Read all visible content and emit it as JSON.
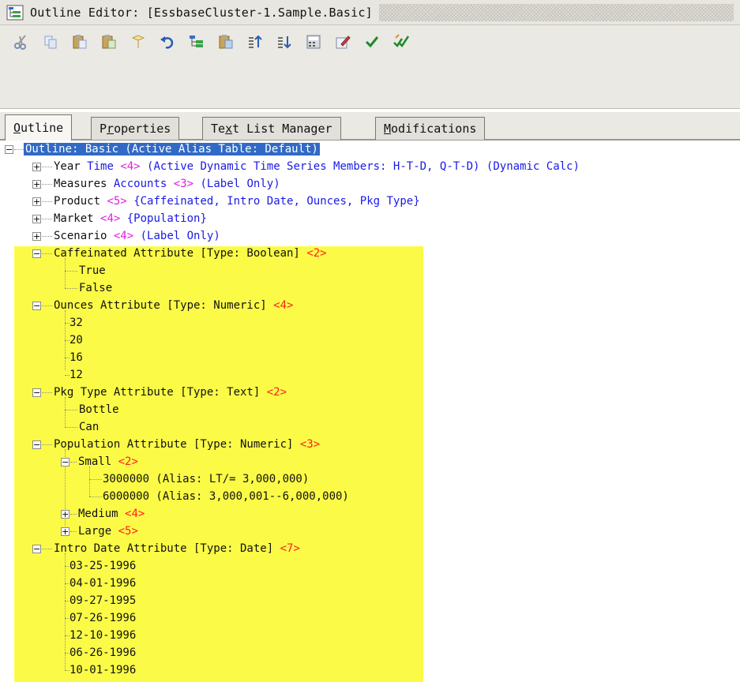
{
  "window": {
    "title": "Outline Editor: [EssbaseCluster-1.Sample.Basic]"
  },
  "toolbar": {
    "buttons": [
      {
        "icon": "cut-icon"
      },
      {
        "icon": "copy-icon"
      },
      {
        "icon": "paste-icon"
      },
      {
        "icon": "paste-child-icon"
      },
      {
        "icon": "delete-icon"
      },
      {
        "icon": "undo-icon"
      },
      {
        "icon": "add-child-icon"
      },
      {
        "icon": "add-sibling-icon"
      },
      {
        "icon": "sort-ascending-icon"
      },
      {
        "icon": "sort-descending-icon"
      },
      {
        "icon": "calculator-icon"
      },
      {
        "icon": "edit-properties-icon"
      },
      {
        "icon": "verify-icon"
      },
      {
        "icon": "verify-all-icon"
      }
    ]
  },
  "tabs": [
    {
      "label_pre": "",
      "label_u": "O",
      "label_post": "utline"
    },
    {
      "label_pre": "P",
      "label_u": "r",
      "label_post": "operties"
    },
    {
      "label_pre": "Te",
      "label_u": "x",
      "label_post": "t List Manager"
    },
    {
      "label_pre": "",
      "label_u": "M",
      "label_post": "odifications"
    }
  ],
  "tree": {
    "root": "Outline: Basic (Active Alias Table: Default)",
    "dimensions": [
      {
        "name": "Year",
        "a": "Time",
        "count": "<4>",
        "b": "(Active Dynamic Time Series Members: H-T-D, Q-T-D) (Dynamic Calc)"
      },
      {
        "name": "Measures",
        "a": "Accounts",
        "count": "<3>",
        "b": "(Label Only)"
      },
      {
        "name": "Product",
        "count": "<5>",
        "b": "{Caffeinated, Intro Date, Ounces, Pkg Type}"
      },
      {
        "name": "Market",
        "count": "<4>",
        "b": "{Population}"
      },
      {
        "name": "Scenario",
        "count": "<4>",
        "b": "(Label Only)"
      }
    ],
    "caffeinated": {
      "label": "Caffeinated Attribute [Type: Boolean]",
      "count": "<2>",
      "children": [
        "True",
        "False"
      ]
    },
    "ounces": {
      "label": "Ounces Attribute [Type: Numeric]",
      "count": "<4>",
      "children": [
        "32",
        "20",
        "16",
        "12"
      ]
    },
    "pkgtype": {
      "label": "Pkg Type Attribute [Type: Text]",
      "count": "<2>",
      "children": [
        "Bottle",
        "Can"
      ]
    },
    "population": {
      "label": "Population Attribute [Type: Numeric]",
      "count": "<3>",
      "small": {
        "label": "Small",
        "count": "<2>",
        "children": [
          "3000000 (Alias: LT/= 3,000,000)",
          "6000000 (Alias: 3,000,001--6,000,000)"
        ]
      },
      "medium": {
        "label": "Medium",
        "count": "<4>"
      },
      "large": {
        "label": "Large",
        "count": "<5>"
      }
    },
    "introdate": {
      "label": "Intro Date Attribute [Type: Date]",
      "count": "<7>",
      "children": [
        "03-25-1996",
        "04-01-1996",
        "09-27-1995",
        "07-26-1996",
        "12-10-1996",
        "06-26-1996",
        "10-01-1996"
      ]
    }
  },
  "colors": {
    "selection": "#316ac5",
    "highlight": "#fbfb47",
    "member_count": "#ff1f1f",
    "dim_type": "#1a1ae6"
  }
}
